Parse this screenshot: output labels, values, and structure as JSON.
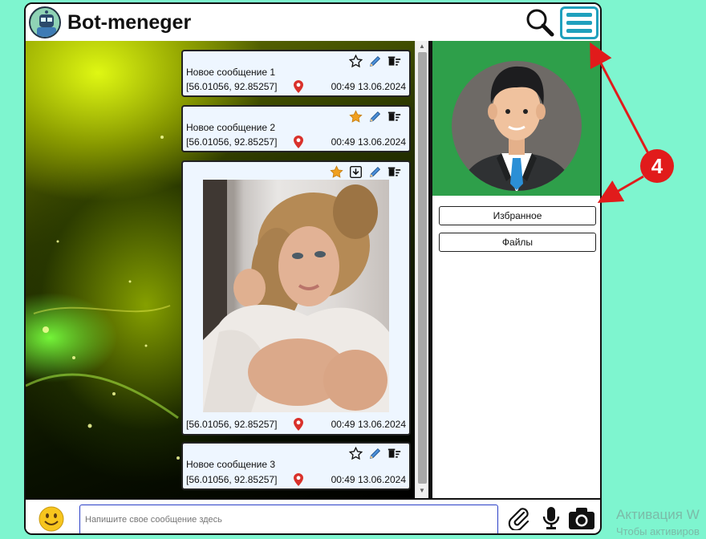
{
  "app": {
    "title": "Bot-meneger"
  },
  "header": {
    "search_icon": "search-icon",
    "menu_icon": "hamburger-menu-icon"
  },
  "messages": [
    {
      "text": "Новое сообщение 1",
      "coords": "[56.01056, 92.85257]",
      "time": "00:49 13.06.2024",
      "starred": false
    },
    {
      "text": "Новое сообщение 2",
      "coords": "[56.01056, 92.85257]",
      "time": "00:49 13.06.2024",
      "starred": true
    },
    {
      "text": "",
      "coords": "[56.01056, 92.85257]",
      "time": "00:49 13.06.2024",
      "starred": true,
      "has_photo": true
    },
    {
      "text": "Новое сообщение 3",
      "coords": "[56.01056, 92.85257]",
      "time": "00:49 13.06.2024",
      "starred": false
    }
  ],
  "profile": {
    "favorites_label": "Избранное",
    "files_label": "Файлы"
  },
  "composer": {
    "placeholder": "Напишите свое сообщение здесь"
  },
  "annotation": {
    "badge": "4"
  },
  "watermark": {
    "line1": "Активация W",
    "line2": "Чтобы активиров"
  },
  "colors": {
    "accent": "#1fa0bd",
    "background": "#7ef5cf",
    "profile_bg": "#2e9f4a",
    "annotation": "#e11b1b",
    "star": "#f0a020"
  }
}
